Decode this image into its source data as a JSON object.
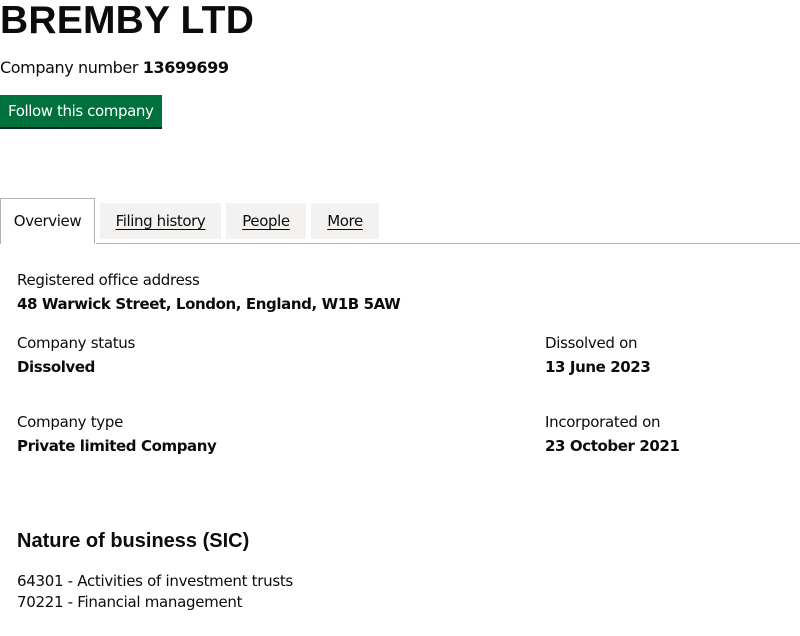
{
  "company": {
    "name": "BREMBY LTD",
    "number_label": "Company number",
    "number": "13699699",
    "follow_label": "Follow this company"
  },
  "tabs": [
    {
      "label": "Overview",
      "active": true
    },
    {
      "label": "Filing history",
      "active": false
    },
    {
      "label": "People",
      "active": false
    },
    {
      "label": "More",
      "active": false
    }
  ],
  "overview": {
    "registered_office": {
      "label": "Registered office address",
      "value": "48 Warwick Street, London, England, W1B 5AW"
    },
    "status": {
      "label": "Company status",
      "value": "Dissolved"
    },
    "dissolved_on": {
      "label": "Dissolved on",
      "value": "13 June 2023"
    },
    "type": {
      "label": "Company type",
      "value": "Private limited Company"
    },
    "incorporated_on": {
      "label": "Incorporated on",
      "value": "23 October 2021"
    }
  },
  "sic": {
    "heading": "Nature of business (SIC)",
    "items": [
      "64301 - Activities of investment trusts",
      "70221 - Financial management"
    ]
  },
  "colors": {
    "button_green": "#00703c",
    "tab_bg": "#f3f2f1",
    "border": "#b1b4b6",
    "text": "#0b0c0c"
  }
}
